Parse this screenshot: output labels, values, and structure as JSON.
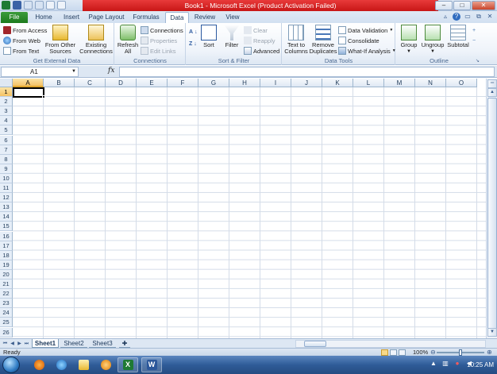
{
  "window": {
    "title": "Book1  -  Microsoft Excel (Product Activation Failed)",
    "controls": {
      "minimize": "–",
      "maximize": "□",
      "close": "✕"
    }
  },
  "tabs": [
    "File",
    "Home",
    "Insert",
    "Page Layout",
    "Formulas",
    "Data",
    "Review",
    "View"
  ],
  "active_tab": "Data",
  "ribbon": {
    "get_external_data": {
      "label": "Get External Data",
      "from_access": "From Access",
      "from_web": "From Web",
      "from_text": "From Text",
      "from_other_sources_1": "From Other",
      "from_other_sources_2": "Sources",
      "existing_connections_1": "Existing",
      "existing_connections_2": "Connections"
    },
    "connections": {
      "label": "Connections",
      "refresh_all_1": "Refresh",
      "refresh_all_2": "All",
      "connections": "Connections",
      "properties": "Properties",
      "edit_links": "Edit Links"
    },
    "sort_filter": {
      "label": "Sort & Filter",
      "sort": "Sort",
      "filter": "Filter",
      "clear": "Clear",
      "reapply": "Reapply",
      "advanced": "Advanced",
      "az": "A",
      "za": "Z"
    },
    "data_tools": {
      "label": "Data Tools",
      "text_to_columns_1": "Text to",
      "text_to_columns_2": "Columns",
      "remove_duplicates_1": "Remove",
      "remove_duplicates_2": "Duplicates",
      "data_validation": "Data Validation",
      "consolidate": "Consolidate",
      "what_if": "What-If Analysis"
    },
    "outline": {
      "label": "Outline",
      "group": "Group",
      "ungroup": "Ungroup",
      "subtotal": "Subtotal"
    }
  },
  "formula_bar": {
    "name_box": "A1",
    "fx": "fx",
    "value": ""
  },
  "columns": [
    "A",
    "B",
    "C",
    "D",
    "E",
    "F",
    "G",
    "H",
    "I",
    "J",
    "K",
    "L",
    "M",
    "N",
    "O"
  ],
  "rows": [
    "1",
    "2",
    "3",
    "4",
    "5",
    "6",
    "7",
    "8",
    "9",
    "10",
    "11",
    "12",
    "13",
    "14",
    "15",
    "16",
    "17",
    "18",
    "19",
    "20",
    "21",
    "22",
    "23",
    "24",
    "25",
    "26"
  ],
  "sheets": [
    "Sheet1",
    "Sheet2",
    "Sheet3"
  ],
  "active_sheet": "Sheet1",
  "status": {
    "ready": "Ready",
    "zoom": "100%"
  },
  "taskbar": {
    "clock": "10:25 AM"
  },
  "colors": {
    "file_tab": "#2a862a",
    "title_red": "#d42020",
    "selection": "#f4c266"
  }
}
